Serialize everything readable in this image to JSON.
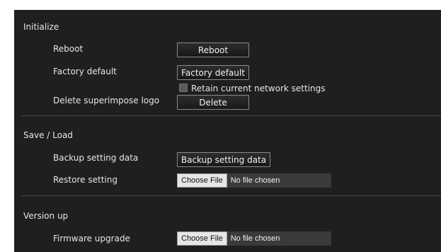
{
  "initialize": {
    "title": "Initialize",
    "reboot_label": "Reboot",
    "reboot_button": "Reboot",
    "factory_default_label": "Factory default",
    "factory_default_button": "Factory default",
    "retain_network_label": "Retain current network settings",
    "retain_network_checked": false,
    "delete_logo_label": "Delete superimpose logo",
    "delete_button": "Delete"
  },
  "save_load": {
    "title": "Save / Load",
    "backup_label": "Backup setting data",
    "backup_button": "Backup setting data",
    "restore_label": "Restore setting",
    "restore_choose_button": "Choose File",
    "restore_status": "No file chosen"
  },
  "version_up": {
    "title": "Version up",
    "firmware_label": "Firmware upgrade",
    "firmware_choose_button": "Choose File",
    "firmware_status": "No file chosen"
  }
}
